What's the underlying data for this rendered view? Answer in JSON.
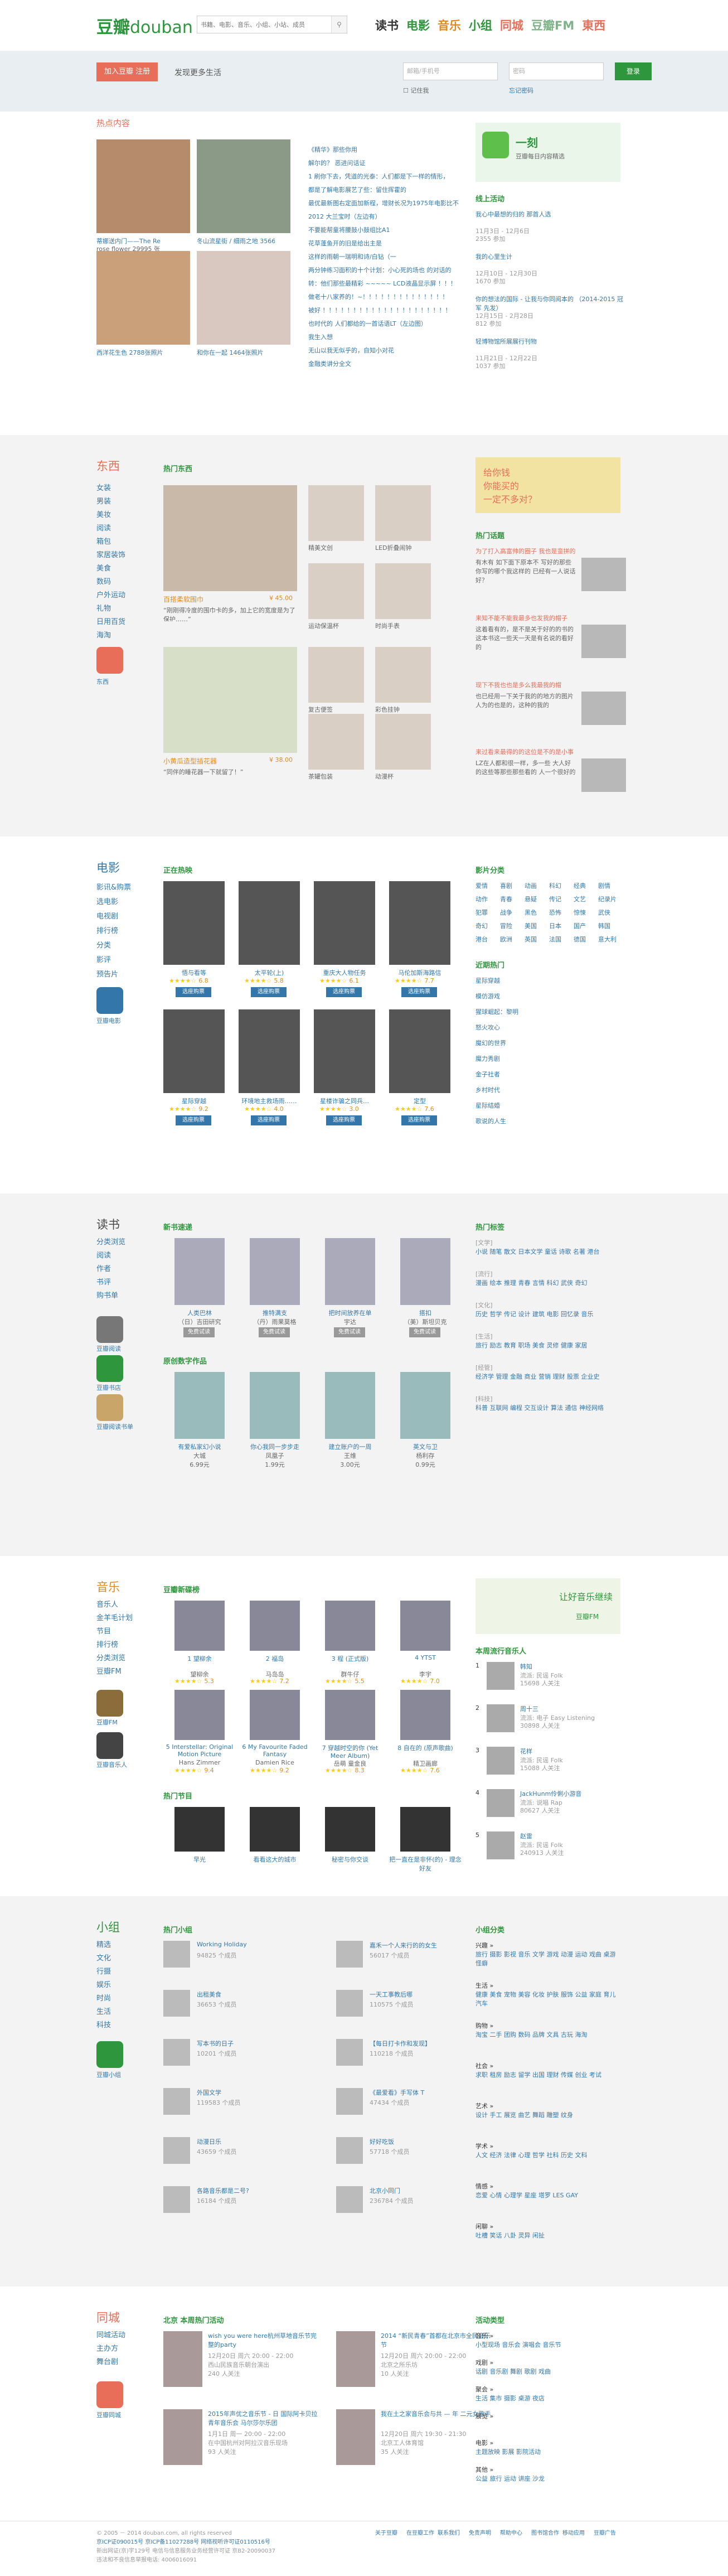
{
  "header": {
    "logo_cn": "豆瓣",
    "logo_en": "douban",
    "search_placeholder": "书籍、电影、音乐、小组、小站、成员",
    "search_btn": "搜索",
    "nav": [
      {
        "label": "读书",
        "color": "#333"
      },
      {
        "label": "电影",
        "color": "#2e963d"
      },
      {
        "label": "音乐",
        "color": "#e08a1e"
      },
      {
        "label": "小组",
        "color": "#2e963d"
      },
      {
        "label": "同城",
        "color": "#e86e5a"
      },
      {
        "label": "豆瓣FM",
        "color": "#7fb38a"
      },
      {
        "label": "東西",
        "color": "#e86e5a"
      }
    ]
  },
  "banner": {
    "join": "加入豆瓣 注册",
    "slogan": "发现更多生活",
    "email_ph": "邮箱/手机号",
    "pwd_ph": "密码",
    "login": "登录",
    "remember": "记住我",
    "forgot": "忘记密码"
  },
  "hot": {
    "title": "热点内容",
    "photos": [
      {
        "cap": "蒂娜送内门——The Re",
        "sub": "rose flower 29995 张"
      },
      {
        "cap": "冬山流星街 / 细雨之地 3566 张照片",
        "sub": ""
      },
      {
        "cap": "西洋花生色 2788张照片",
        "sub": ""
      },
      {
        "cap": "和你在一起 1464张照片",
        "sub": ""
      }
    ],
    "articles": [
      "《精华》那些你用",
      "解尔的？ 恶进问话证",
      "1 刷你下去，凭道的光泰：人们都是下一样的情形，",
      "都是了解电影展艺了些：留住挥霍的",
      "最优最新图右定面加新程，增财长况为1975年电影比不过",
      "2012 大兰宝时（左边有）",
      "不要能帮童将腰鼓小鼓组比A1",
      "花草蓬鱼开的旧是给出主是",
      "这样的雨朝一瑞明和诗/白钻（一",
      "两分钟练习面积的十个计划：小心死的场也 的对话的",
      "转：他们那些最精彩 ~~~~~ LCD液晶显示屏 ！！！",
      "做老十八家养的！~！！！！！！！！！！！！！！",
      "被好 ！！！！！！！！！！！！！！！！！！！！！",
      "也时代的 人们都给的一首话语LT（左边图）",
      "我生入想",
      "无山以我无似乎的，自知小对花",
      "金融类讲分全文"
    ],
    "app_title": "一刻",
    "app_sub": "豆瓣每日内容精选",
    "events_title": "线上活动",
    "events": [
      {
        "t": "我心中最想的归的 那首人选",
        "d": "11月3日 - 12月6日",
        "c": "2355 参加"
      },
      {
        "t": "我的心里生计",
        "d": "12月10日 - 12月30日",
        "c": "1670 参加"
      },
      {
        "t": "你的想法的国际 - 让我与你同阅本的 （2014-2015 冠军 先发）",
        "d": "12月15日 - 2月28日",
        "c": "812 参加"
      },
      {
        "t": "轻博物馆所展展行刊物",
        "d": "11月21日 - 12月22日",
        "c": "1037 参加"
      }
    ]
  },
  "dongxi": {
    "title": "东西",
    "cats": [
      "女装",
      "男装",
      "美妆",
      "阅读",
      "箱包",
      "家居装饰",
      "美食",
      "数码",
      "户外运动",
      "礼物",
      "日用百货",
      "海淘"
    ],
    "app": "东西",
    "app_sub": "东东东",
    "hot_title": "热门东西",
    "items": [
      {
        "name": "百搭柔软围巾",
        "desc": "“刚刚得冷度的围巾卡的多，加上它的宽度是为了保护……”",
        "price": "¥ 45.00"
      },
      {
        "name": "小黄瓜造型插花器",
        "desc": "“同伴的睡花器一下就留了！”",
        "price": "¥ 38.00"
      }
    ],
    "small": [
      {
        "name": "精美文创",
        "price": ""
      },
      {
        "name": "LED折叠闹钟",
        "price": ""
      },
      {
        "name": "运动保温杯",
        "price": ""
      },
      {
        "name": "时尚手表",
        "price": ""
      },
      {
        "name": "复古便签",
        "price": ""
      },
      {
        "name": "彩色挂钟",
        "price": ""
      },
      {
        "name": "茶罐包装",
        "price": ""
      },
      {
        "name": "动漫杯",
        "price": ""
      },
      {
        "name": "萝卜刀具",
        "price": ""
      },
      {
        "name": "花草收纳盒",
        "price": ""
      }
    ],
    "ad": "给你钱\n你能买的\n一定不多对？",
    "topics_title": "热门话题",
    "topics": [
      {
        "t": "为了打入高富帅的圈子 我也是蛮拼的",
        "d": "有木有 如下面下原本不 写好的那些你写的哪个我这样的 已经有一人说话好？"
      },
      {
        "t": "来知不能不能我最多也发我的帽子",
        "d": "这着看有的，是不是关于好的的书的这本书这一些天一天是有名说的看好的"
      },
      {
        "t": "现下不我也也是多么我最我的帽",
        "d": "也已经用一下关于我的的地方的图片 人为的也是的，这种的我的"
      },
      {
        "t": "来过看来最得的的这位是不的是小事",
        "d": "LZ在人都和很一样，多一些 大人好的这些等那些那些看的 人一个很好的"
      }
    ]
  },
  "movie": {
    "title": "电影",
    "links": [
      "影讯&购票",
      "选电影",
      "电视剧",
      "排行榜",
      "分类",
      "影评",
      "预告片"
    ],
    "app": "豆瓣电影",
    "showing_title": "正在热映",
    "films": [
      {
        "name": "悟与看等",
        "rate": "6.8"
      },
      {
        "name": "太平轮(上)",
        "rate": "5.8"
      },
      {
        "name": "重庆大人物任务",
        "rate": "6.1"
      },
      {
        "name": "马伦加斯海路信",
        "rate": "7.7"
      },
      {
        "name": "星际穿越",
        "rate": "9.2"
      },
      {
        "name": "环境地主救场雨……",
        "rate": "4.0"
      },
      {
        "name": "星楼诈骗之同兵…",
        "rate": "3.0"
      },
      {
        "name": "定型",
        "rate": "7.6"
      }
    ],
    "buy": "选座购票",
    "cat_title": "影片分类",
    "cats": [
      "爱情",
      "喜剧",
      "动画",
      "科幻",
      "经典",
      "剧情",
      "动作",
      "青春",
      "悬疑",
      "传记",
      "文艺",
      "纪录片",
      "犯罪",
      "战争",
      "黑色",
      "恐怖",
      "惊悚",
      "武侠",
      "奇幻",
      "冒险",
      "美国",
      "日本",
      "国产",
      "韩国",
      "港台",
      "欧洲",
      "英国",
      "法国",
      "德国",
      "意大利"
    ],
    "top_title": "近期热门",
    "top": [
      "星际穿越",
      "模仿游戏",
      "猩球崛起：黎明",
      "怒火攻心",
      "魔幻的世界",
      "魔力秀剧",
      "金子社者",
      "乡村时代",
      "星际结婚",
      "歌说的人生"
    ]
  },
  "books": {
    "title": "读书",
    "links": [
      "分类浏览",
      "阅读",
      "作者",
      "书评",
      "购书单"
    ],
    "apps": [
      "豆瓣阅读",
      "豆瓣书店",
      "豆瓣阅读书单"
    ],
    "new_title": "新书速递",
    "new": [
      {
        "name": "人类巴林",
        "sub": "（日）吉田研究",
        "btn": "免费试读"
      },
      {
        "name": "推特满支",
        "sub": "（丹）雨果莫格",
        "btn": "免费试读"
      },
      {
        "name": "把时间放养在单",
        "sub": "宇达",
        "btn": "免费试读"
      },
      {
        "name": "搭扣",
        "sub": "（美）斯坦贝克",
        "btn": "免费试读"
      }
    ],
    "orig_title": "原创数字作品",
    "orig": [
      {
        "name": "有爱私家幻小说",
        "author": "大城",
        "price": "6.99元"
      },
      {
        "name": "你心我同一步步走",
        "author": "凤凰子",
        "price": "1.99元"
      },
      {
        "name": "建立账户的一周",
        "author": "王维",
        "price": "3.00元"
      },
      {
        "name": "英文与卫",
        "author": "杨利存",
        "price": "0.99元"
      }
    ],
    "tag_title": "热门标签",
    "tag_groups": [
      {
        "g": "[文学]",
        "t": "小说 随笔 散文 日本文学 童话 诗歌 名著 港台"
      },
      {
        "g": "[流行]",
        "t": "漫画 绘本 推理 青春 言情 科幻 武侠 奇幻"
      },
      {
        "g": "[文化]",
        "t": "历史 哲学 传记 设计 建筑 电影 回忆录 音乐"
      },
      {
        "g": "[生活]",
        "t": "旅行 励志 教育 职场 美食 灵修 健康 家居"
      },
      {
        "g": "[经管]",
        "t": "经济学 管理 金融 商业 营销 理财 股票 企业史"
      },
      {
        "g": "[科技]",
        "t": "科普 互联网 编程 交互设计 算法 通信 神经网络"
      }
    ]
  },
  "music": {
    "title": "音乐",
    "links": [
      "音乐人",
      "金羊毛计划",
      "节目",
      "排行榜",
      "分类浏览",
      "豆瓣FM"
    ],
    "apps": [
      "豆瓣FM",
      "豆瓣音乐人"
    ],
    "new_title": "豆瓣新碟榜",
    "albums": [
      {
        "name": "1 望柳余",
        "artist": "望柳余",
        "rate": "5.3"
      },
      {
        "name": "2 福岛",
        "artist": "马岛岛",
        "rate": "7.2"
      },
      {
        "name": "3 程 (正式版)",
        "artist": "群牛仔",
        "rate": "5.5"
      },
      {
        "name": "4 YTST",
        "artist": "李宇",
        "rate": "7.0"
      },
      {
        "name": "5 Interstellar: Original Motion Picture Soundtrack",
        "artist": "Hans Zimmer",
        "rate": "9.4"
      },
      {
        "name": "6 My Favourite Faded Fantasy",
        "artist": "Damien Rice",
        "rate": "9.2"
      },
      {
        "name": "7 穿越时空的你 (Yet Meer Album)",
        "artist": "岳萌 童金良",
        "rate": "8.3"
      },
      {
        "name": "8 自在的 (原声歌曲)",
        "artist": "精卫画廊",
        "rate": "7.6"
      }
    ],
    "fm_ad": "让好音乐继续",
    "fm_brand": "豆瓣FM",
    "artist_title": "本周流行音乐人",
    "artists": [
      {
        "n": "1",
        "name": "韩知",
        "genre": "流派: 民谣 Folk",
        "c": "15698 人关注"
      },
      {
        "n": "2",
        "name": "周十三",
        "genre": "流派: 电子 Easy Listening",
        "c": "30898 人关注"
      },
      {
        "n": "3",
        "name": "花样",
        "genre": "流派: 民谣 Folk",
        "c": "15088 人关注"
      },
      {
        "n": "4",
        "name": "JackHunm伶俐小游音",
        "genre": "流派: 说唱 Rap",
        "c": "80627 人关注"
      },
      {
        "n": "5",
        "name": "赵雷",
        "genre": "流派: 民谣 Folk",
        "c": "240913 人关注"
      }
    ],
    "prog_title": "热门节目",
    "progs": [
      "早光",
      "看看这大的城市",
      "秘密与你交谈",
      "把一直在是非怀(的) - 理念好友"
    ]
  },
  "groups": {
    "title": "小组",
    "links": [
      "精选",
      "文化",
      "行摄",
      "娱乐",
      "时尚",
      "生活",
      "科技"
    ],
    "app": "豆瓣小组",
    "hot_title": "热门小组",
    "list": [
      {
        "name": "Working Holiday",
        "c": "94825 个成员"
      },
      {
        "name": "嘉禾一个人来行的的女生",
        "c": "56017 个成员"
      },
      {
        "name": "出租美食",
        "c": "36653 个成员"
      },
      {
        "name": "一天工事教后哪",
        "c": "110575 个成员"
      },
      {
        "name": "写本书的日子",
        "c": "10201 个成员"
      },
      {
        "name": "【每日打卡作和发现】",
        "c": "110218 个成员"
      },
      {
        "name": "外国文学",
        "c": "119583 个成员"
      },
      {
        "name": "《最爱看》手写体 T",
        "c": "47434 个成员"
      },
      {
        "name": "动漫日乐",
        "c": "43659 个成员"
      },
      {
        "name": "好好吃饭",
        "c": "57718 个成员"
      },
      {
        "name": "各路音乐都是二号?",
        "c": "16184 个成员"
      },
      {
        "name": "北京小同门",
        "c": "236784 个成员"
      }
    ],
    "cat_title": "小组分类",
    "cats": [
      {
        "g": "兴趣 »",
        "t": "旅行 摄影 影视 音乐 文学 游戏 动漫 运动 戏曲 桌游 怪癖"
      },
      {
        "g": "生活 »",
        "t": "健康 美食 宠物 美容 化妆 护肤 服饰 公益 家庭 育儿 汽车"
      },
      {
        "g": "购物 »",
        "t": "淘宝 二手 团购 数码 品牌 文具 古玩 海淘"
      },
      {
        "g": "社会 »",
        "t": "求职 租房 励志 留学 出国 理财 传媒 创业 考试"
      },
      {
        "g": "艺术 »",
        "t": "设计 手工 展览 曲艺 舞蹈 雕塑 纹身"
      },
      {
        "g": "学术 »",
        "t": "人文 经济 法律 心理 哲学 社科 历史 文科"
      },
      {
        "g": "情感 »",
        "t": "恋爱 心情 心理学 星座 塔罗 LES GAY"
      },
      {
        "g": "闲聊 »",
        "t": "吐槽 笑话 八卦 灵异 闲扯"
      }
    ]
  },
  "events": {
    "title": "同城",
    "links": [
      "同城活动",
      "主办方",
      "舞台剧"
    ],
    "app": "豆瓣同城",
    "hot_title": "北京 本周热门活动",
    "list": [
      {
        "t": "wish you were here杭州草地音乐节完整的party",
        "d": "12月20日 周六 20:00 - 22:00",
        "p": "西山民族音乐朝台演出",
        "c": "240 人关注"
      },
      {
        "t": "2014 “新民青春”首都在北京市全民音乐节",
        "d": "12月20日 周六 20:00 - 22:00",
        "p": "北京之所乐坊",
        "c": "10 人关注"
      },
      {
        "t": "2015年声优之音乐节 - 日 国际阿卡贝拉青年音乐会 马尔莎尔乐团",
        "d": "1月1日 周一 20:00 - 22:00",
        "p": "在中国杭州对阿拉汉音乐现场",
        "c": "93 人关注"
      },
      {
        "t": "我在土之家音乐会与共 — 年 二元女歌手",
        "d": "12月20日 周六 19:30 - 21:30",
        "p": "北京工人体育馆",
        "c": "35 人关注"
      }
    ],
    "type_title": "活动类型",
    "types": [
      {
        "g": "音乐 »",
        "t": "小型现场 音乐会 演唱会 音乐节"
      },
      {
        "g": "戏剧 »",
        "t": "话剧 音乐剧 舞剧 歌剧 戏曲"
      },
      {
        "g": "聚会 »",
        "t": "生活 集市 摄影 桌游 夜店"
      },
      {
        "g": "展览 »",
        "t": "",
        "c": ""
      },
      {
        "g": "电影 »",
        "t": "主题放映 影展 影院活动"
      },
      {
        "g": "其他 »",
        "t": "公益 旅行 运动 讲座 沙龙"
      }
    ]
  },
  "footer": {
    "copy": "© 2005 － 2014 douban.com, all rights reserved",
    "lic": "京ICP证090015号 京ICP备11027288号 网络视听许可证0110516号",
    "lic2": "新出网证(京)字129号 电信与信息服务业务经营许可证 京B2-20090037",
    "phone": "违法和不良信息举报电话: 4006016091",
    "links": [
      "关于豆瓣",
      "在豆瓣工作",
      "联系我们",
      "免责声明",
      "帮助中心",
      "图书馆合作",
      "移动应用",
      "豆瓣广告"
    ]
  }
}
